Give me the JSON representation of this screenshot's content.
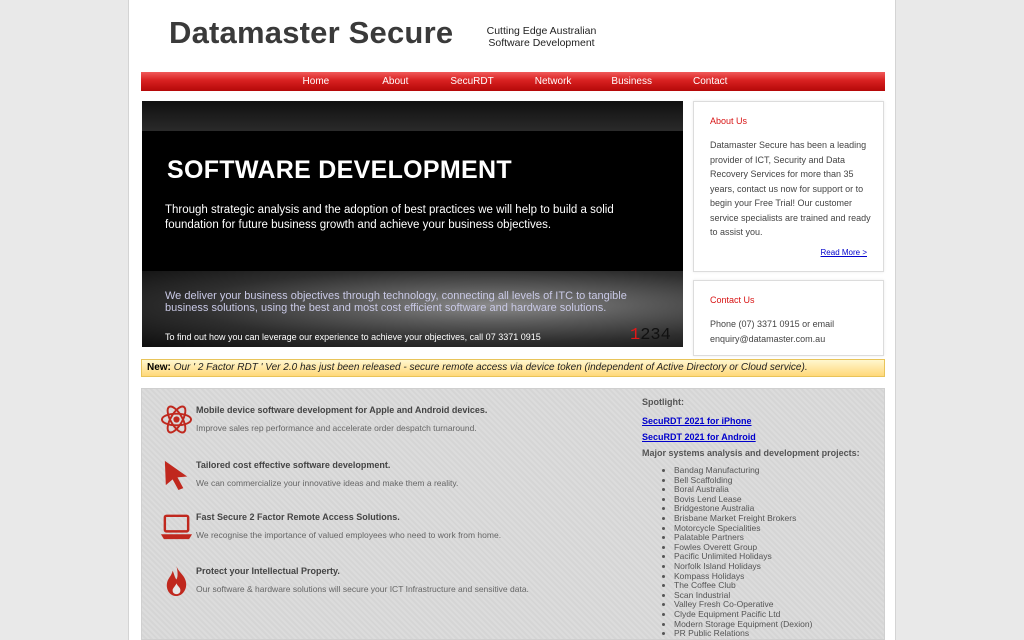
{
  "header": {
    "title": "Datamaster Secure",
    "tagline_line1": "Cutting Edge Australian",
    "tagline_line2": "Software Development"
  },
  "nav": {
    "items": [
      "Home",
      "About",
      "SecuRDT",
      "Network",
      "Business",
      "Contact"
    ]
  },
  "banner": {
    "heading": "SOFTWARE DEVELOPMENT",
    "text": "Through strategic analysis and the adoption of best practices we will help to build a solid foundation for future business growth and achieve your business objectives.",
    "subtext": "We deliver your business objectives through technology, connecting all levels of ITC to tangible business solutions, using the best and most cost efficient software and hardware solutions.",
    "cta": "To find out how you can leverage our experience to achieve your objectives, call 07 3371 0915",
    "pager": [
      "1",
      "2",
      "3",
      "4"
    ]
  },
  "about": {
    "title": "About Us",
    "text": "Datamaster Secure has been a leading provider of ICT, Security and Data Recovery Services for more than 35 years, contact us now for support or to begin your Free Trial! Our customer service specialists are trained and ready to assist you.",
    "read_more": "Read More >"
  },
  "contact": {
    "title": "Contact Us",
    "text": "Phone (07) 3371 0915 or email enquiry@datamaster.com.au"
  },
  "news": {
    "label": "New:",
    "text": "Our ' 2 Factor RDT ' Ver 2.0 has just been released - secure remote access via device token (independent of Active Directory or Cloud service)."
  },
  "features": [
    {
      "icon": "atom-icon",
      "title": "Mobile device software development for Apple and Android devices.",
      "desc": "Improve sales rep performance and accelerate order despatch turnaround."
    },
    {
      "icon": "cursor-arrow-icon",
      "title": "Tailored cost effective software development.",
      "desc": "We can commercialize your innovative ideas and make them a reality."
    },
    {
      "icon": "laptop-icon",
      "title": "Fast Secure 2 Factor Remote Access Solutions.",
      "desc": "We recognise the importance of valued employees who need to work from home."
    },
    {
      "icon": "fire-icon",
      "title": "Protect your Intellectual Property.",
      "desc": "Our software & hardware solutions will secure your ICT Infrastructure and sensitive data."
    }
  ],
  "sidebar": {
    "spotlight_label": "Spotlight:",
    "links": [
      "SecuRDT 2021 for iPhone",
      "SecuRDT 2021 for Android"
    ],
    "projects_heading": "Major systems analysis and development projects:",
    "projects": [
      "Bandag Manufacturing",
      "Bell Scaffolding",
      "Boral Australia",
      "Bovis Lend Lease",
      "Bridgestone Australia",
      "Brisbane Market Freight Brokers",
      "Motorcycle Specialities",
      "Palatable Partners",
      "Fowles Overett Group",
      "Pacific Unlimited Holidays",
      "Norfolk Island Holidays",
      "Kompass Holidays",
      "The Coffee Club",
      "Scan Industrial",
      "Valley Fresh Co-Operative",
      "Clyde Equipment Pacific Ltd",
      "Modern Storage Equipment (Dexion)",
      "PR Public Relations"
    ]
  },
  "colors": {
    "accent": "#d81414",
    "link": "#0000cc",
    "news_bg": "#ffd87a"
  }
}
